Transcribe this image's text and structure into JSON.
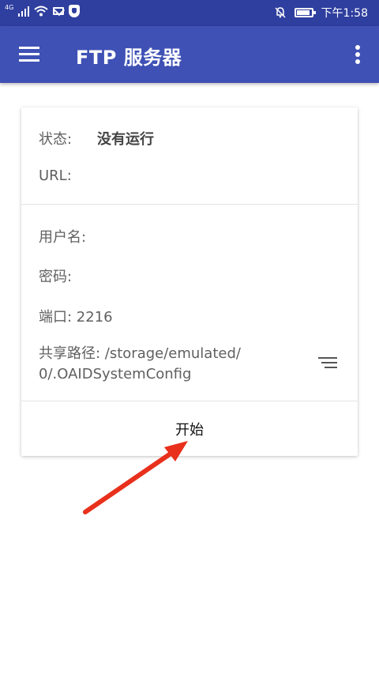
{
  "status_bar": {
    "network": "4G",
    "time": "下午1:58"
  },
  "app_bar": {
    "title": "FTP 服务器"
  },
  "card": {
    "status_label": "状态:",
    "status_value": "没有运行",
    "url_label": "URL:",
    "username_label": "用户名:",
    "password_label": "密码:",
    "port_label": "端口: 2216",
    "share_path_line1": "共享路径: /storage/emulated/",
    "share_path_line2": "0/.OAIDSystemConfig",
    "start_label": "开始"
  },
  "colors": {
    "status_bar": "#2f3f9f",
    "app_bar": "#3f51b5",
    "annotation_arrow": "#e8301c"
  },
  "icons": [
    "menu-icon",
    "more-vert-icon",
    "sort-icon",
    "wifi-icon",
    "mail-icon",
    "shield-icon",
    "mute-bell-icon",
    "battery-icon"
  ]
}
